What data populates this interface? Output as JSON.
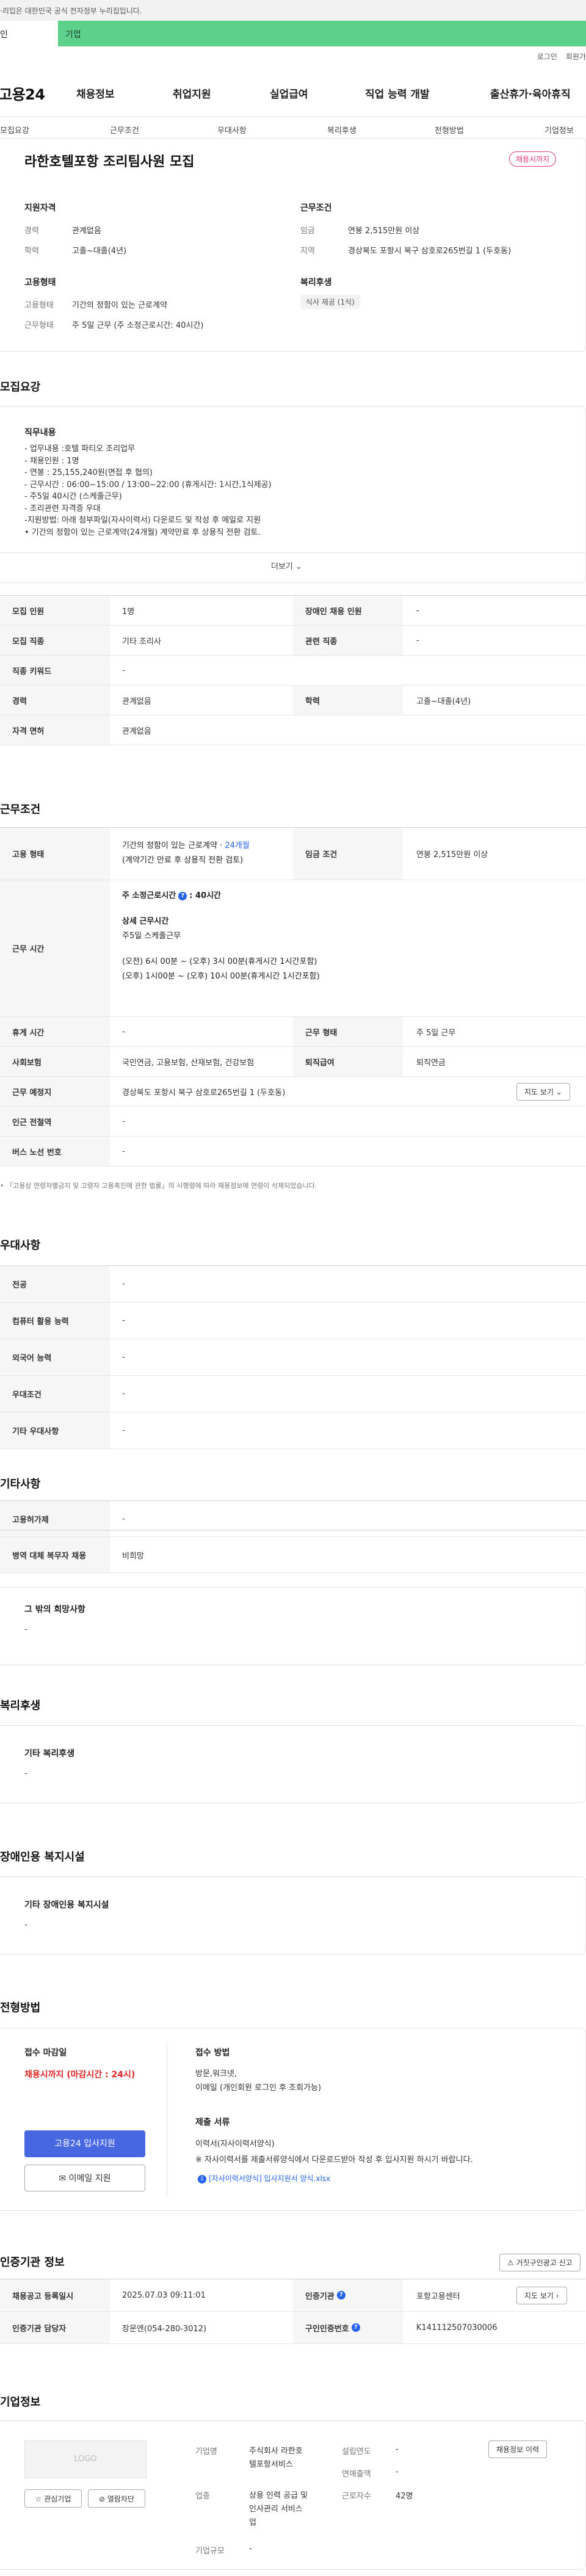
{
  "gov_banner": "·리입은 대한민국 공식 전자정부 누리집입니다.",
  "user_tabs": {
    "person": "인",
    "company": "기업"
  },
  "util": {
    "login": "로그인",
    "join": "회원가"
  },
  "logo": "고용24",
  "gnb": [
    "채용정보",
    "취업지원",
    "실업급여",
    "직업 능력 개발",
    "출산휴가·육아휴직"
  ],
  "sub_tabs": [
    "모집요강",
    "근무조건",
    "우대사항",
    "복리후생",
    "전형방법",
    "기업정보"
  ],
  "summary": {
    "title": "라한호텔포항 조리팀사원 모집",
    "status": "채용시까지",
    "qual_head": "지원자격",
    "qual": [
      {
        "k": "경력",
        "v": "관계없음"
      },
      {
        "k": "학력",
        "v": "고졸~대졸(4년)"
      }
    ],
    "cond_head": "근무조건",
    "cond": [
      {
        "k": "임금",
        "v": "연봉 2,515만원 이상"
      },
      {
        "k": "지역",
        "v": "경상북도 포항시 북구 삼호로265번길 1 (두호동)"
      }
    ],
    "emp_head": "고용형태",
    "emp": [
      {
        "k": "고용형태",
        "v": "기간의 정함이 있는 근로계약"
      },
      {
        "k": "근무형태",
        "v": "주 5일 근무 (주 소정근로시간: 40시간)"
      }
    ],
    "welfare_head": "복리후생",
    "welfare_pill": "식사 제공 (1식)"
  },
  "recruit": {
    "title": "모집요강",
    "desc_head": "직무내용",
    "desc_lines": [
      "- 업무내용 :호텔 파티오 조리업무",
      "- 채용인원 : 1명",
      "- 연봉 : 25,155,240원(면접 후 협의)",
      "- 근무시간 : 06:00~15:00 / 13:00~22:00 (휴게시간: 1시간,1식제공)",
      "- 주5일 40시간 (스케줄근무)",
      "- 조리관련 자격증 우대",
      "-지원방법: 아래 첨부파일(자사이력서) 다운로드 및 작성 후 메일로 지원",
      "• 기간의 정함이 있는 근로계약(24개월) 계약만료 후 상용직 전환 검토."
    ],
    "more": "더보기 ⌄",
    "rows": [
      {
        "th1": "모집 인원",
        "td1": "1명",
        "th2": "장애인 채용 인원",
        "td2": "-"
      },
      {
        "th1": "모집 직종",
        "td1": "기타 조리사",
        "th2": "관련 직종",
        "td2": "-"
      },
      {
        "th1": "직종 키워드",
        "td1": "-"
      },
      {
        "th1": "경력",
        "td1": "관계없음",
        "th2": "학력",
        "td2": "고졸~대졸(4년)"
      },
      {
        "th1": "자격 면허",
        "td1": "관계없음"
      }
    ]
  },
  "work": {
    "title": "근무조건",
    "emp_type_th": "고용 형태",
    "emp_type_line1": "기간의 정함이 있는 근로계약 · ",
    "emp_type_months": "24개월",
    "emp_type_line2": "(계약기간 만료 후 상용직 전환 검토)",
    "wage_th": "임금 조건",
    "wage_td": "연봉 2,515만원 이상",
    "hours_th": "근무 시간",
    "hours_weekly_label": "주 소정근로시간",
    "hours_weekly_value": ": 40시간",
    "hours_detail_head": "상세 근무시간",
    "hours_detail_1": "주5일 스케줄근무",
    "hours_detail_2": "(오전) 6시 00분 ~ (오후) 3시 00분(휴게시간 1시간포함)",
    "hours_detail_3": "(오후) 1시00분 ~ (오후) 10시 00분(휴게시간 1시간포함)",
    "rows": [
      {
        "th1": "휴게 시간",
        "td1": "-",
        "th2": "근무 형태",
        "td2": "주 5일 근무"
      },
      {
        "th1": "사회보험",
        "td1": "국민연금, 고용보험, 산재보험, 건강보험",
        "th2": "퇴직급여",
        "td2": "퇴직연금"
      }
    ],
    "place_th": "근무 예정지",
    "place_td": "경상북도 포항시 북구 삼호로265번길 1 (두호동)",
    "map_btn": "지도 보기 ⌄",
    "subway_th": "인근 전철역",
    "subway_td": "-",
    "bus_th": "버스 노선 번호",
    "bus_td": "-",
    "note": "• 「고용상 연령차별금지 및 고령자 고용촉진에 관한 법률」의 시행령에 따라 채용정보에 연령이 삭제되었습니다."
  },
  "pref": {
    "title": "우대사항",
    "rows": [
      {
        "th": "전공",
        "td": "-"
      },
      {
        "th": "컴퓨터 활용 능력",
        "td": "-"
      },
      {
        "th": "외국어 능력",
        "td": "-"
      },
      {
        "th": "우대조건",
        "td": "-"
      },
      {
        "th": "기타 우대사항",
        "td": "-"
      }
    ]
  },
  "etc": {
    "title": "기타사항",
    "rows": [
      {
        "th": "고용허가제",
        "td": "-"
      },
      {
        "th": "병역 대체 복무자 채용",
        "td": "비희망"
      }
    ],
    "box_head": "그 밖의 희망사항",
    "box_value": "-"
  },
  "welfare": {
    "title": "복리후생",
    "box_head": "기타 복리후생",
    "box_value": "-"
  },
  "disabled": {
    "title": "장애인용 복지시설",
    "box_head": "기타 장애인용 복지시설",
    "box_value": "-"
  },
  "selection": {
    "title": "전형방법",
    "deadline_head": "접수 마감일",
    "deadline_value": "채용시까지 (마감시간 : 24시)",
    "apply_button": "고용24 입사지원",
    "email_button": "✉ 이메일 지원",
    "method_head": "접수 방법",
    "method_lines": [
      "방문,워크넷,",
      "이메일 (개인회원 로그인 후 조회가능)"
    ],
    "docs_head": "제출 서류",
    "docs_lines": [
      "이력서(자사이력서양식)",
      "※ 자사이력서를 제출서류양식에서 다운로드받아 작성 후 입사지원 하시기 바랍니다."
    ],
    "file_link": "[자사이력서양식] 입사지원서 양식.xlsx"
  },
  "certify": {
    "title": "인증기관 정보",
    "report_btn": "⚠ 거짓구인광고 신고",
    "rows": [
      {
        "th1": "채용공고 등록일시",
        "td1": "2025.07.03 09:11:01",
        "th2": "인증기관",
        "td2": "포항고용센터"
      },
      {
        "th1": "인증기관 담당자",
        "td1": "장문엔(054-280-3012)",
        "th2": "구인인증번호",
        "td2": "K141112507030006"
      }
    ],
    "map_btn": "지도 보기 ›"
  },
  "company": {
    "title": "기업정보",
    "logo_text": "LOGO",
    "interest_btn": "☆ 관심기업",
    "block_btn": "⊘ 열람차단",
    "history_btn": "채용정보 이력",
    "fields": {
      "name_label": "기업명",
      "name_value": [
        "주식회사 라한호",
        "텔포항서비스"
      ],
      "industry_label": "업종",
      "industry_value": [
        "상용 인력 공급 및",
        "인사관리 서비스",
        "업"
      ],
      "size_label": "기업규모",
      "size_value": "-",
      "founded_label": "설립연도",
      "founded_value": "-",
      "sales_label": "연매출액",
      "sales_value": "-",
      "employees_label": "근로자수",
      "employees_value": "42명"
    }
  }
}
